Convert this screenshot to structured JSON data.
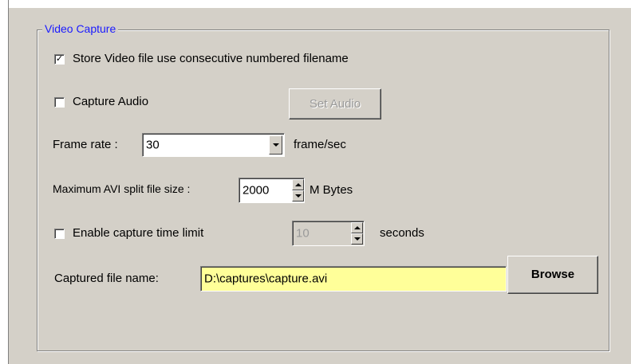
{
  "group": {
    "title": "Video Capture"
  },
  "options": {
    "store_numbered": {
      "label": "Store Video file use consecutive numbered filename",
      "checked": "✓"
    },
    "capture_audio": {
      "label": "Capture Audio",
      "checked": ""
    },
    "set_audio_button": "Set Audio",
    "frame_rate": {
      "label": "Frame rate :",
      "value": "30",
      "unit": "frame/sec"
    },
    "split_size": {
      "label": "Maximum AVI split file size :",
      "value": "2000",
      "unit": "M Bytes"
    },
    "time_limit": {
      "label": "Enable capture time limit",
      "checked": "",
      "value": "10",
      "unit": "seconds"
    },
    "file_name": {
      "label": "Captured file name:",
      "value": "D:\\captures\\capture.avi",
      "browse": "Browse"
    }
  },
  "colors": {
    "title": "#1a1aff",
    "filename_bg": "#ffff99"
  }
}
